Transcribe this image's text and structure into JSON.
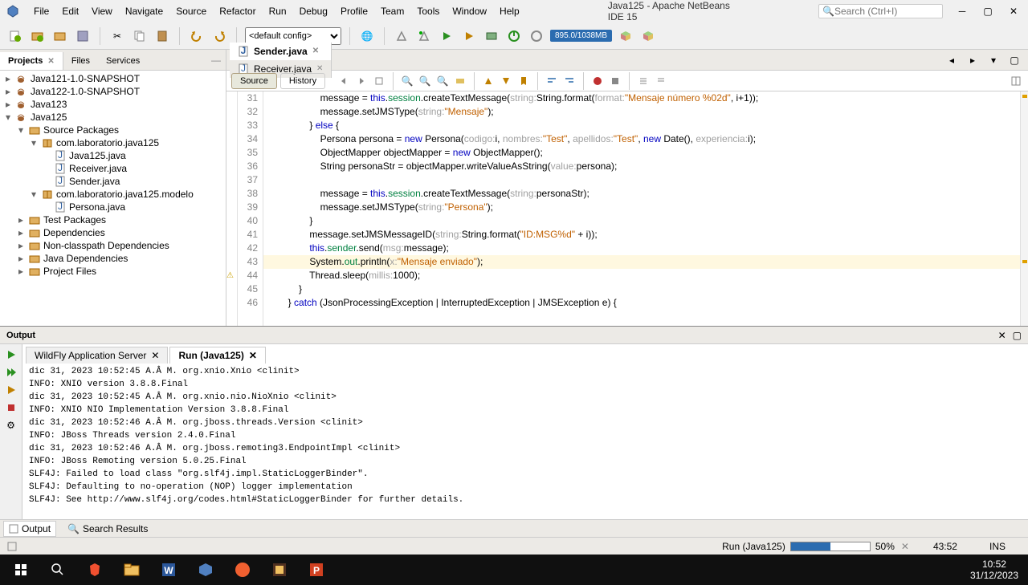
{
  "menubar": {
    "items": [
      "File",
      "Edit",
      "View",
      "Navigate",
      "Source",
      "Refactor",
      "Run",
      "Debug",
      "Profile",
      "Team",
      "Tools",
      "Window",
      "Help"
    ],
    "app_title": "Java125 - Apache NetBeans IDE 15",
    "search_placeholder": "Search (Ctrl+I)"
  },
  "toolbar": {
    "config": "<default config>",
    "memory": "895.0/1038MB"
  },
  "sidebar": {
    "tabs": [
      "Projects",
      "Files",
      "Services"
    ],
    "active_tab": 0,
    "tree": [
      {
        "depth": 0,
        "toggle": "▸",
        "icon": "coffee",
        "label": "Java121-1.0-SNAPSHOT"
      },
      {
        "depth": 0,
        "toggle": "▸",
        "icon": "coffee",
        "label": "Java122-1.0-SNAPSHOT"
      },
      {
        "depth": 0,
        "toggle": "▸",
        "icon": "coffee",
        "label": "Java123"
      },
      {
        "depth": 0,
        "toggle": "▾",
        "icon": "coffee",
        "label": "Java125"
      },
      {
        "depth": 1,
        "toggle": "▾",
        "icon": "folder",
        "label": "Source Packages"
      },
      {
        "depth": 2,
        "toggle": "▾",
        "icon": "package",
        "label": "com.laboratorio.java125"
      },
      {
        "depth": 3,
        "toggle": "",
        "icon": "java",
        "label": "Java125.java"
      },
      {
        "depth": 3,
        "toggle": "",
        "icon": "java",
        "label": "Receiver.java"
      },
      {
        "depth": 3,
        "toggle": "",
        "icon": "java",
        "label": "Sender.java"
      },
      {
        "depth": 2,
        "toggle": "▾",
        "icon": "package",
        "label": "com.laboratorio.java125.modelo"
      },
      {
        "depth": 3,
        "toggle": "",
        "icon": "java",
        "label": "Persona.java"
      },
      {
        "depth": 1,
        "toggle": "▸",
        "icon": "folder",
        "label": "Test Packages"
      },
      {
        "depth": 1,
        "toggle": "▸",
        "icon": "folder",
        "label": "Dependencies"
      },
      {
        "depth": 1,
        "toggle": "▸",
        "icon": "folder",
        "label": "Non-classpath Dependencies"
      },
      {
        "depth": 1,
        "toggle": "▸",
        "icon": "folder",
        "label": "Java Dependencies"
      },
      {
        "depth": 1,
        "toggle": "▸",
        "icon": "folder",
        "label": "Project Files"
      }
    ]
  },
  "editor": {
    "tabs": [
      {
        "icon": "java",
        "label": "Sender.java",
        "active": true
      },
      {
        "icon": "java",
        "label": "Receiver.java",
        "active": false
      }
    ],
    "sub_tabs": [
      "Source",
      "History"
    ],
    "active_sub": 0,
    "lines": [
      {
        "n": 31,
        "seg": [
          {
            "t": "                    message = ",
            "c": ""
          },
          {
            "t": "this",
            "c": "kw"
          },
          {
            "t": ".",
            "c": ""
          },
          {
            "t": "session",
            "c": "fld"
          },
          {
            "t": ".createTextMessage(",
            "c": ""
          },
          {
            "t": "string:",
            "c": "hint"
          },
          {
            "t": "String.",
            "c": ""
          },
          {
            "t": "format",
            "c": "meth"
          },
          {
            "t": "(",
            "c": ""
          },
          {
            "t": "format:",
            "c": "hint"
          },
          {
            "t": "\"Mensaje número %02d\"",
            "c": "str"
          },
          {
            "t": ", i+1));",
            "c": ""
          }
        ]
      },
      {
        "n": 32,
        "seg": [
          {
            "t": "                    message.setJMSType(",
            "c": ""
          },
          {
            "t": "string:",
            "c": "hint"
          },
          {
            "t": "\"Mensaje\"",
            "c": "str"
          },
          {
            "t": ");",
            "c": ""
          }
        ]
      },
      {
        "n": 33,
        "seg": [
          {
            "t": "                } ",
            "c": ""
          },
          {
            "t": "else",
            "c": "kw"
          },
          {
            "t": " {",
            "c": ""
          }
        ]
      },
      {
        "n": 34,
        "seg": [
          {
            "t": "                    Persona persona = ",
            "c": ""
          },
          {
            "t": "new",
            "c": "kw"
          },
          {
            "t": " Persona(",
            "c": ""
          },
          {
            "t": "codigo:",
            "c": "hint"
          },
          {
            "t": "i, ",
            "c": ""
          },
          {
            "t": "nombres:",
            "c": "hint"
          },
          {
            "t": "\"Test\"",
            "c": "str"
          },
          {
            "t": ", ",
            "c": ""
          },
          {
            "t": "apellidos:",
            "c": "hint"
          },
          {
            "t": "\"Test\"",
            "c": "str"
          },
          {
            "t": ", ",
            "c": ""
          },
          {
            "t": "new",
            "c": "kw"
          },
          {
            "t": " Date(), ",
            "c": ""
          },
          {
            "t": "experiencia:",
            "c": "hint"
          },
          {
            "t": "i);",
            "c": ""
          }
        ]
      },
      {
        "n": 35,
        "seg": [
          {
            "t": "                    ObjectMapper objectMapper = ",
            "c": ""
          },
          {
            "t": "new",
            "c": "kw"
          },
          {
            "t": " ObjectMapper();",
            "c": ""
          }
        ]
      },
      {
        "n": 36,
        "seg": [
          {
            "t": "                    String personaStr = objectMapper.writeValueAsString(",
            "c": ""
          },
          {
            "t": "value:",
            "c": "hint"
          },
          {
            "t": "persona);",
            "c": ""
          }
        ]
      },
      {
        "n": 37,
        "seg": [
          {
            "t": "",
            "c": ""
          }
        ]
      },
      {
        "n": 38,
        "seg": [
          {
            "t": "                    message = ",
            "c": ""
          },
          {
            "t": "this",
            "c": "kw"
          },
          {
            "t": ".",
            "c": ""
          },
          {
            "t": "session",
            "c": "fld"
          },
          {
            "t": ".createTextMessage(",
            "c": ""
          },
          {
            "t": "string:",
            "c": "hint"
          },
          {
            "t": "personaStr);",
            "c": ""
          }
        ]
      },
      {
        "n": 39,
        "seg": [
          {
            "t": "                    message.setJMSType(",
            "c": ""
          },
          {
            "t": "string:",
            "c": "hint"
          },
          {
            "t": "\"Persona\"",
            "c": "str"
          },
          {
            "t": ");",
            "c": ""
          }
        ]
      },
      {
        "n": 40,
        "seg": [
          {
            "t": "                }",
            "c": ""
          }
        ]
      },
      {
        "n": 41,
        "seg": [
          {
            "t": "                message.setJMSMessageID(",
            "c": ""
          },
          {
            "t": "string:",
            "c": "hint"
          },
          {
            "t": "String.",
            "c": ""
          },
          {
            "t": "format",
            "c": "meth"
          },
          {
            "t": "(",
            "c": ""
          },
          {
            "t": "\"ID:MSG%d\"",
            "c": "str"
          },
          {
            "t": " + i));",
            "c": ""
          }
        ]
      },
      {
        "n": 42,
        "seg": [
          {
            "t": "                ",
            "c": ""
          },
          {
            "t": "this",
            "c": "kw"
          },
          {
            "t": ".",
            "c": ""
          },
          {
            "t": "sender",
            "c": "fld"
          },
          {
            "t": ".send(",
            "c": ""
          },
          {
            "t": "msg:",
            "c": "hint"
          },
          {
            "t": "message);",
            "c": ""
          }
        ]
      },
      {
        "n": 43,
        "hl": true,
        "seg": [
          {
            "t": "                System.",
            "c": ""
          },
          {
            "t": "out",
            "c": "fld"
          },
          {
            "t": ".println(",
            "c": ""
          },
          {
            "t": "x:",
            "c": "hint"
          },
          {
            "t": "\"Mensaje enviado\"",
            "c": "str"
          },
          {
            "t": ");",
            "c": ""
          }
        ]
      },
      {
        "n": 44,
        "warn": true,
        "seg": [
          {
            "t": "                Thread.",
            "c": ""
          },
          {
            "t": "sleep",
            "c": "meth"
          },
          {
            "t": "(",
            "c": ""
          },
          {
            "t": "millis:",
            "c": "hint"
          },
          {
            "t": "1000);",
            "c": ""
          }
        ]
      },
      {
        "n": 45,
        "seg": [
          {
            "t": "            }",
            "c": ""
          }
        ]
      },
      {
        "n": 46,
        "seg": [
          {
            "t": "        } ",
            "c": ""
          },
          {
            "t": "catch",
            "c": "kw"
          },
          {
            "t": " (JsonProcessingException | InterruptedException | JMSException e) {",
            "c": ""
          }
        ]
      }
    ]
  },
  "output": {
    "title": "Output",
    "tabs": [
      {
        "label": "WildFly Application Server",
        "active": false
      },
      {
        "label": "Run (Java125)",
        "active": true
      }
    ],
    "lines": [
      "dic 31, 2023 10:52:45 A.Â M. org.xnio.Xnio <clinit>",
      "INFO: XNIO version 3.8.8.Final",
      "dic 31, 2023 10:52:45 A.Â M. org.xnio.nio.NioXnio <clinit>",
      "INFO: XNIO NIO Implementation Version 3.8.8.Final",
      "dic 31, 2023 10:52:46 A.Â M. org.jboss.threads.Version <clinit>",
      "INFO: JBoss Threads version 2.4.0.Final",
      "dic 31, 2023 10:52:46 A.Â M. org.jboss.remoting3.EndpointImpl <clinit>",
      "INFO: JBoss Remoting version 5.0.25.Final",
      "SLF4J: Failed to load class \"org.slf4j.impl.StaticLoggerBinder\".",
      "SLF4J: Defaulting to no-operation (NOP) logger implementation",
      "SLF4J: See http://www.slf4j.org/codes.html#StaticLoggerBinder for further details."
    ]
  },
  "bottom_tabs": {
    "output": "Output",
    "search": "Search Results"
  },
  "status": {
    "run_label": "Run (Java125)",
    "progress_pct": 50,
    "pct_text": "50%",
    "time": "43:52",
    "mode": "INS"
  },
  "taskbar": {
    "clock": "10:52",
    "date": "31/12/2023"
  }
}
